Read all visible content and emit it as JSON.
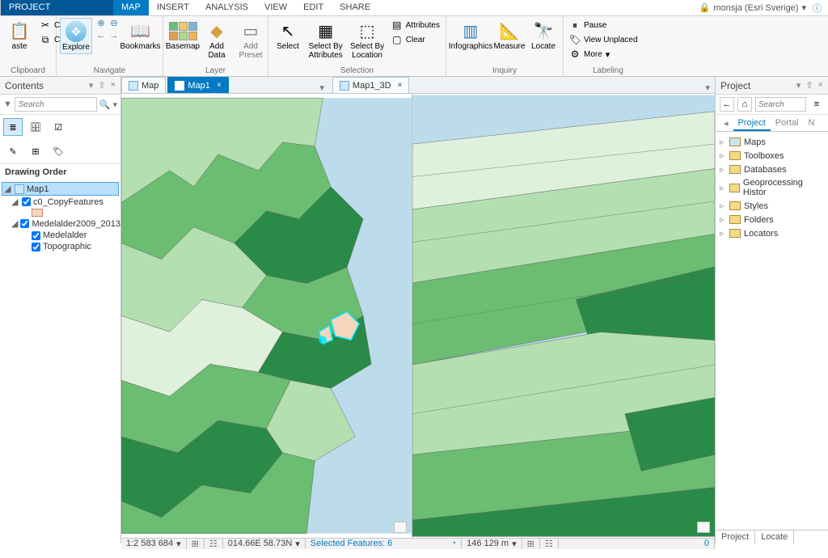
{
  "menu": {
    "tabs": [
      "PROJECT",
      "MAP",
      "INSERT",
      "ANALYSIS",
      "VIEW",
      "EDIT",
      "SHARE"
    ],
    "active": 1,
    "user": "monsja (Esri Sverige)"
  },
  "ribbon": {
    "clipboard": {
      "paste": "aste",
      "cut": "Cut",
      "copy": "Copy",
      "group": "Clipboard"
    },
    "navigate": {
      "explore": "Explore",
      "bookmarks": "Bookmarks",
      "group": "Navigate"
    },
    "layer": {
      "basemap": "Basemap",
      "addData": "Add\nData",
      "addPreset": "Add\nPreset",
      "group": "Layer"
    },
    "selection": {
      "select": "Select",
      "byAttr": "Select By\nAttributes",
      "byLoc": "Select By\nLocation",
      "attributes": "Attributes",
      "clear": "Clear",
      "group": "Selection"
    },
    "inquiry": {
      "infographics": "Infographics",
      "measure": "Measure",
      "locate": "Locate",
      "group": "Inquiry"
    },
    "labeling": {
      "pause": "Pause",
      "viewUnplaced": "View Unplaced",
      "more": "More",
      "group": "Labeling"
    }
  },
  "contents": {
    "title": "Contents",
    "searchPlaceholder": "Search",
    "heading": "Drawing Order",
    "tree": {
      "map": "Map1",
      "layer1": "c0_CopyFeatures",
      "layer2": "Medelalder2009_2013",
      "sub1": "Medelalder",
      "sub2": "Topographic"
    }
  },
  "views": {
    "list": [
      "Map",
      "Map1",
      "Map1_3D"
    ],
    "activeIndex": 1
  },
  "status": {
    "left": {
      "scale": "1:2 583 684",
      "coords": "014.66E 58.73N",
      "selected": "Selected Features: 6"
    },
    "right": {
      "scale3d": "146 129 m",
      "count": "0"
    }
  },
  "project": {
    "title": "Project",
    "searchPlaceholder": "Search",
    "tabs": [
      "Project",
      "Portal",
      "N"
    ],
    "activeTab": 0,
    "items": [
      "Maps",
      "Toolboxes",
      "Databases",
      "Geoprocessing Histor",
      "Styles",
      "Folders",
      "Locators"
    ],
    "itemColors": [
      "#c9e2f5",
      "#d89a3a",
      "#d89a3a",
      "#d89a3a",
      "#d89a3a",
      "#d89a3a",
      "#d89a3a"
    ],
    "bottom": [
      "Project",
      "Locate"
    ]
  }
}
